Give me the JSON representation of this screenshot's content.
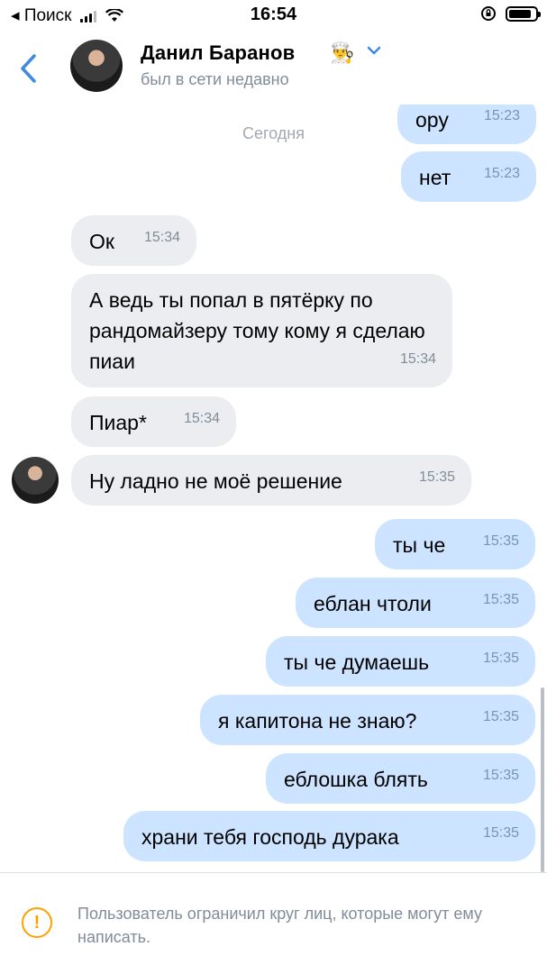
{
  "status_bar": {
    "back_app": "◂ Поиск",
    "time": "16:54"
  },
  "header": {
    "name": "Данил Баранов",
    "badge_emoji": "👨‍🍳",
    "last_seen": "был в сети недавно"
  },
  "chat": {
    "date_separator": "Сегодня",
    "messages": [
      {
        "dir": "out",
        "text": "ору",
        "time": "15:23"
      },
      {
        "dir": "out",
        "text": "нет",
        "time": "15:23"
      },
      {
        "dir": "in",
        "text": "Ок",
        "time": "15:34"
      },
      {
        "dir": "in",
        "text": "А ведь ты попал в пятёрку по рандомайзеру тому кому я сделаю пиаи",
        "time": "15:34"
      },
      {
        "dir": "in",
        "text": "Пиар*",
        "time": "15:34"
      },
      {
        "dir": "in",
        "text": "Ну ладно не моё решение",
        "time": "15:35"
      },
      {
        "dir": "out",
        "text": "ты че",
        "time": "15:35"
      },
      {
        "dir": "out",
        "text": "еблан чтоли",
        "time": "15:35"
      },
      {
        "dir": "out",
        "text": "ты че думаешь",
        "time": "15:35"
      },
      {
        "dir": "out",
        "text": "я капитона не знаю?",
        "time": "15:35"
      },
      {
        "dir": "out",
        "text": "еблошка блять",
        "time": "15:35"
      },
      {
        "dir": "out",
        "text": "храни тебя господь дурака",
        "time": "15:35"
      }
    ]
  },
  "footer": {
    "warning_icon": "!",
    "message": "Пользователь ограничил круг лиц, которые могут ему написать."
  },
  "colors": {
    "accent": "#3f8ae0",
    "incoming_bubble": "#ebedf0",
    "outgoing_bubble": "#cce4ff",
    "secondary_text": "#818c99",
    "warning": "#ffa000"
  }
}
